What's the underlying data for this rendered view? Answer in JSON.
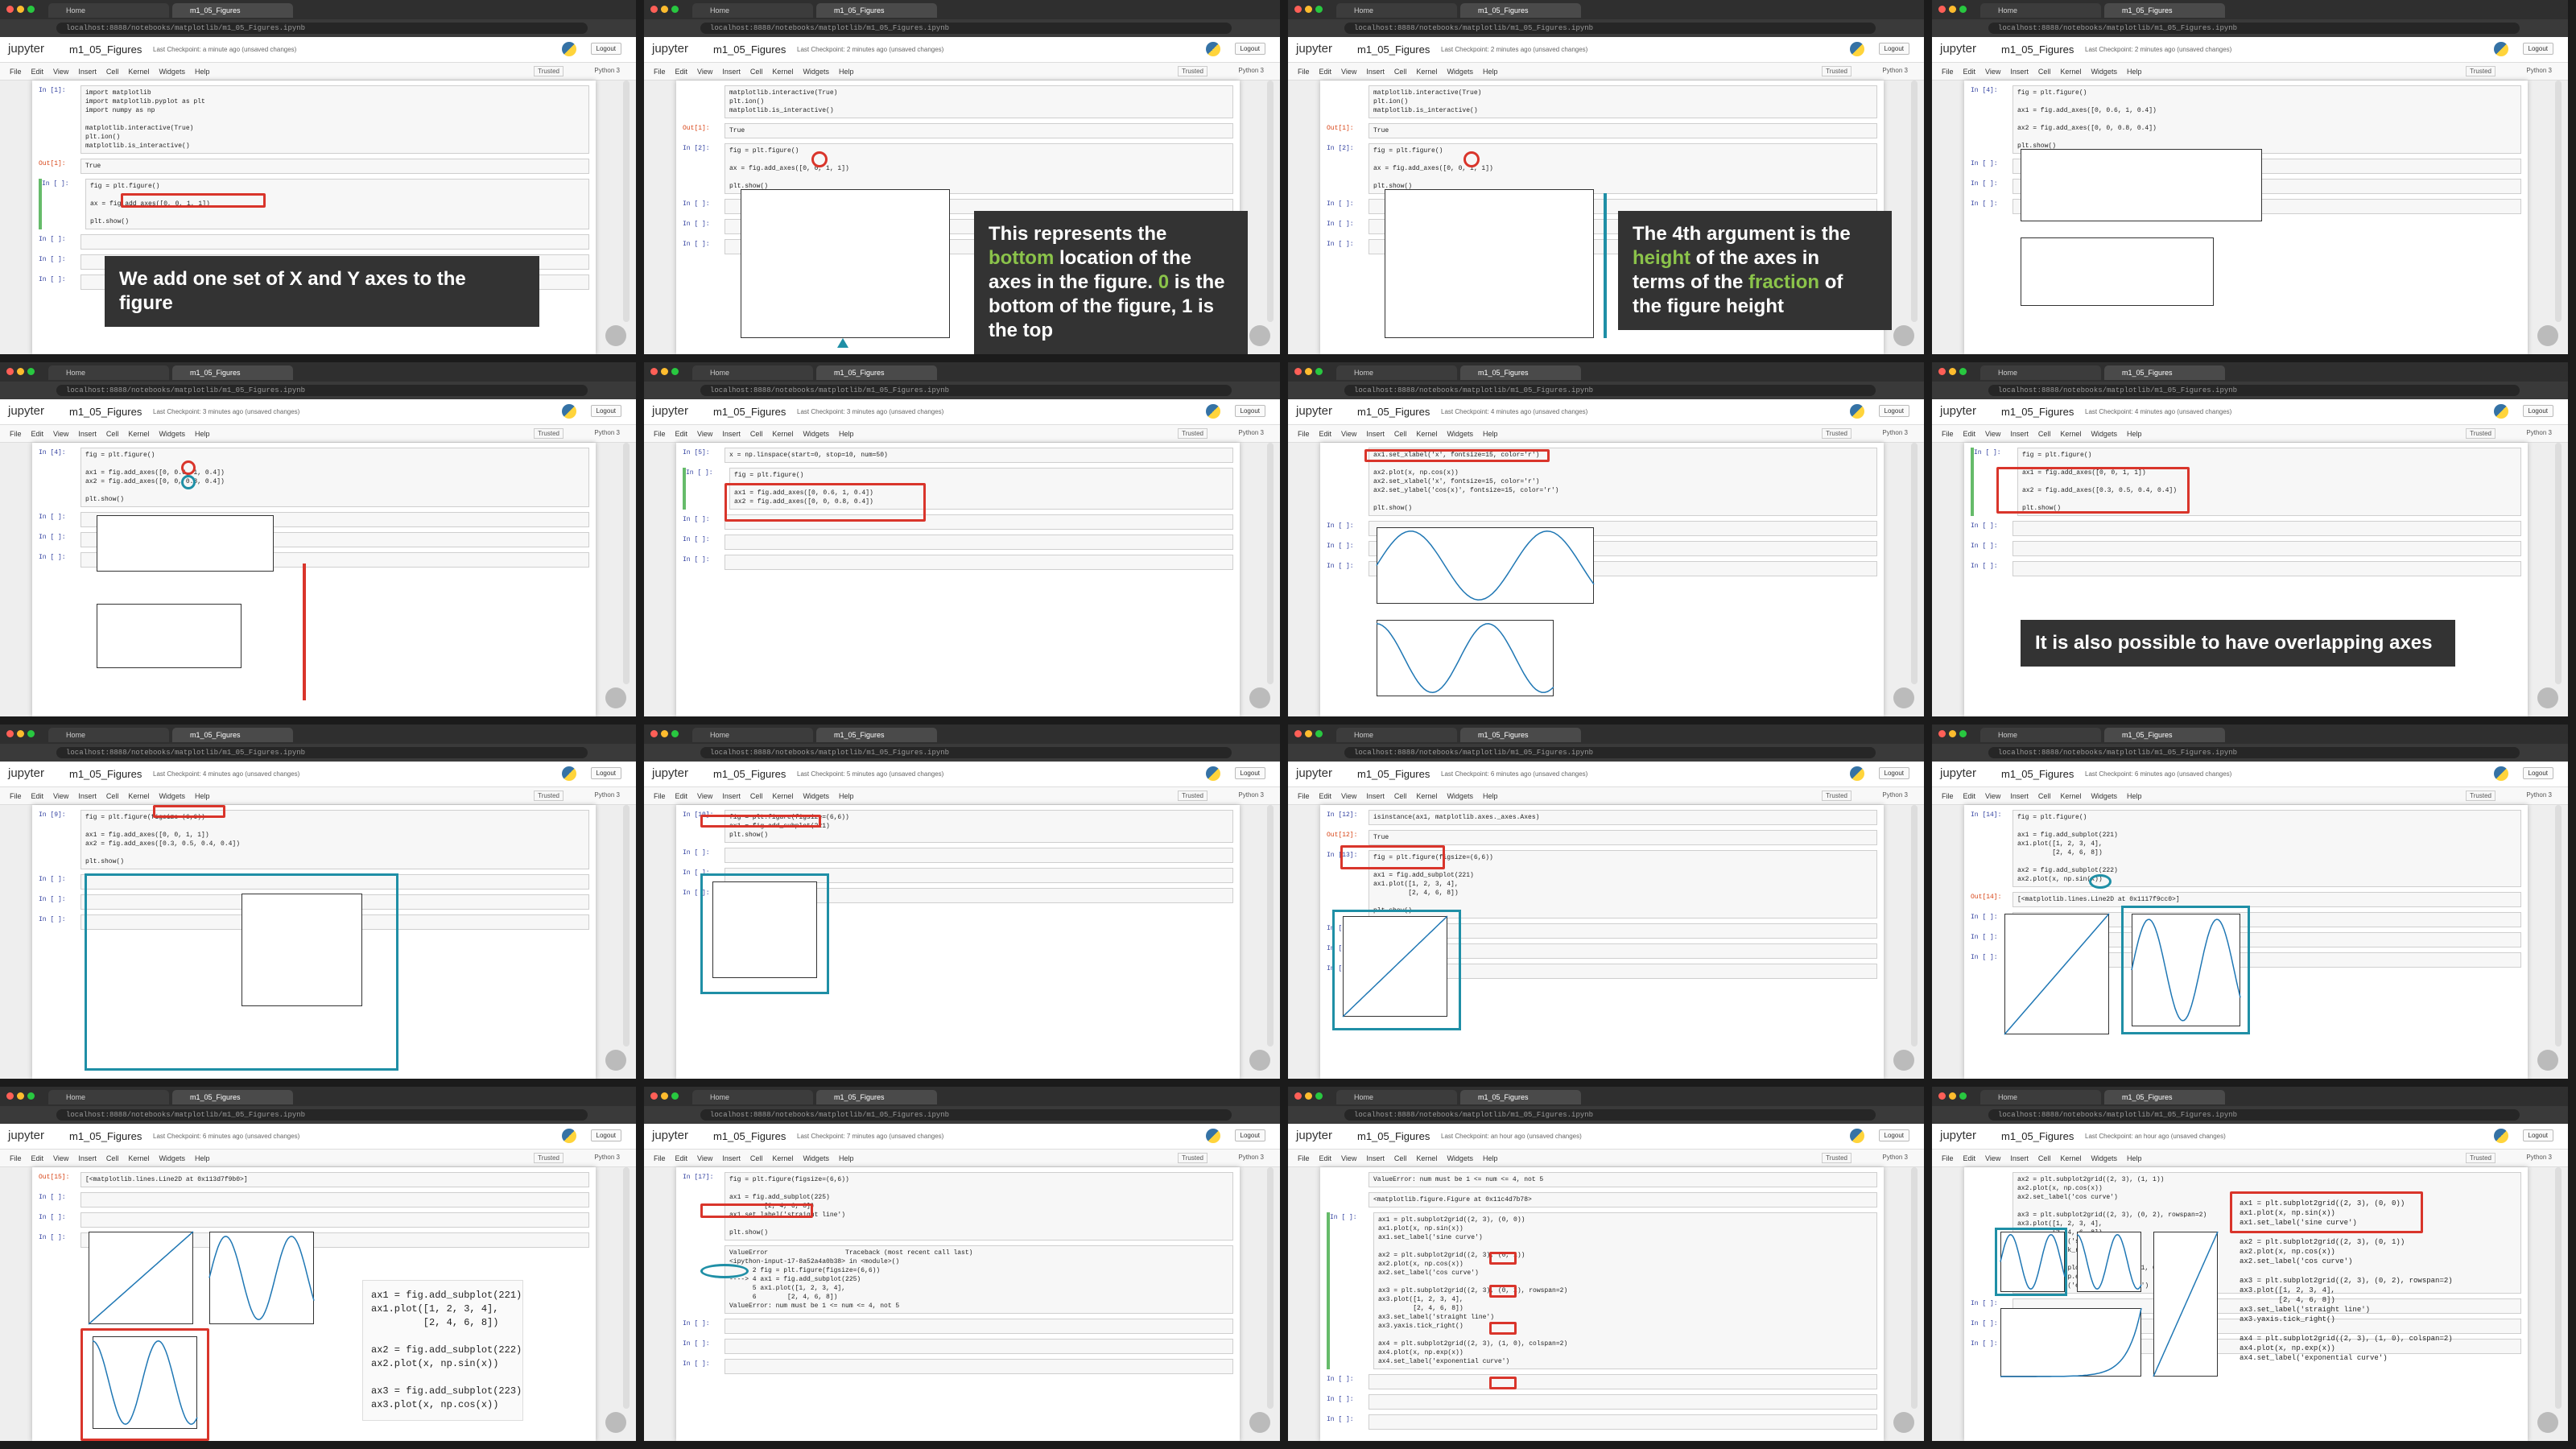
{
  "browser": {
    "tab_home": "Home",
    "tab_notebook": "m1_05_Figures",
    "url": "localhost:8888/notebooks/matplotlib/m1_05_Figures.ipynb"
  },
  "jupyter": {
    "logo": "jupyter",
    "notebook_name": "m1_05_Figures",
    "logout": "Logout",
    "trusted": "Trusted",
    "kernel": "Python 3",
    "menu": [
      "File",
      "Edit",
      "View",
      "Insert",
      "Cell",
      "Kernel",
      "Widgets",
      "Help"
    ]
  },
  "tiles": [
    {
      "checkpoint": "Last Checkpoint: a minute ago   (unsaved changes)",
      "cells": [
        {
          "prompt": "In [1]:",
          "src": "import matplotlib\nimport matplotlib.pyplot as plt\nimport numpy as np\n\nmatplotlib.interactive(True)\nplt.ion()\nmatplotlib.is_interactive()"
        },
        {
          "prompt": "Out[1]:",
          "src": "True"
        },
        {
          "prompt": "In [ ]:",
          "src": "fig = plt.figure()\n\nax = fig.add_axes([0, 0, 1, 1])\n\nplt.show()"
        }
      ],
      "caption": "We add one set of X and Y axes to the figure"
    },
    {
      "checkpoint": "Last Checkpoint: 2 minutes ago   (unsaved changes)",
      "cells": [
        {
          "prompt": "",
          "src": "matplotlib.interactive(True)\nplt.ion()\nmatplotlib.is_interactive()"
        },
        {
          "prompt": "Out[1]:",
          "src": "True"
        },
        {
          "prompt": "In [2]:",
          "src": "fig = plt.figure()\n\nax = fig.add_axes([0, 0, 1, 1])\n\nplt.show()"
        }
      ],
      "caption_parts": [
        "This represents the ",
        "bottom",
        " location of the axes in the figure. ",
        "0",
        " is the bottom of the figure, 1 is the top"
      ]
    },
    {
      "checkpoint": "Last Checkpoint: 2 minutes ago   (unsaved changes)",
      "cells": [
        {
          "prompt": "",
          "src": "matplotlib.interactive(True)\nplt.ion()\nmatplotlib.is_interactive()"
        },
        {
          "prompt": "Out[1]:",
          "src": "True"
        },
        {
          "prompt": "In [2]:",
          "src": "fig = plt.figure()\n\nax = fig.add_axes([0, 0, 1, 1])\n\nplt.show()"
        }
      ],
      "caption_parts": [
        "The 4th argument is the ",
        "height",
        " of the axes in terms of the ",
        "fraction",
        " of the figure height"
      ]
    },
    {
      "checkpoint": "Last Checkpoint: 2 minutes ago   (unsaved changes)",
      "cells": [
        {
          "prompt": "In [4]:",
          "src": "fig = plt.figure()\n\nax1 = fig.add_axes([0, 0.6, 1, 0.4])\n\nax2 = fig.add_axes([0, 0, 0.8, 0.4])\n\nplt.show()"
        }
      ]
    },
    {
      "checkpoint": "Last Checkpoint: 3 minutes ago   (unsaved changes)",
      "cells": [
        {
          "prompt": "In [4]:",
          "src": "fig = plt.figure()\n\nax1 = fig.add_axes([0, 0.6, 1, 0.4])\nax2 = fig.add_axes([0, 0, 0.8, 0.4])\n\nplt.show()"
        }
      ]
    },
    {
      "checkpoint": "Last Checkpoint: 3 minutes ago   (unsaved changes)",
      "cells": [
        {
          "prompt": "In [5]:",
          "src": "x = np.linspace(start=0, stop=10, num=50)"
        },
        {
          "prompt": "In [ ]:",
          "src": "fig = plt.figure()\n\nax1 = fig.add_axes([0, 0.6, 1, 0.4])\nax2 = fig.add_axes([0, 0, 0.8, 0.4])"
        }
      ]
    },
    {
      "checkpoint": "Last Checkpoint: 4 minutes ago   (unsaved changes)",
      "cells": [
        {
          "prompt": "",
          "src": "ax1.set_xlabel('x', fontsize=15, color='r')\n\nax2.plot(x, np.cos(x))\nax2.set_xlabel('x', fontsize=15, color='r')\nax2.set_ylabel('cos(x)', fontsize=15, color='r')\n\nplt.show()"
        }
      ]
    },
    {
      "checkpoint": "Last Checkpoint: 4 minutes ago   (unsaved changes)",
      "cells": [
        {
          "prompt": "In [ ]:",
          "src": "fig = plt.figure()\n\nax1 = fig.add_axes([0, 0, 1, 1])\n\nax2 = fig.add_axes([0.3, 0.5, 0.4, 0.4])\n\nplt.show()"
        }
      ],
      "caption": "It is also possible to have overlapping axes"
    },
    {
      "checkpoint": "Last Checkpoint: 4 minutes ago   (unsaved changes)",
      "cells": [
        {
          "prompt": "In [9]:",
          "src": "fig = plt.figure(figsize=(6,6))\n\nax1 = fig.add_axes([0, 0, 1, 1])\nax2 = fig.add_axes([0.3, 0.5, 0.4, 0.4])\n\nplt.show()"
        }
      ]
    },
    {
      "checkpoint": "Last Checkpoint: 5 minutes ago   (unsaved changes)",
      "cells": [
        {
          "prompt": "In [10]:",
          "src": "fig = plt.figure(figsize=(6,6))\nax1 = fig.add_subplot(221)\nplt.show()"
        }
      ]
    },
    {
      "checkpoint": "Last Checkpoint: 6 minutes ago   (unsaved changes)",
      "cells": [
        {
          "prompt": "In [12]:",
          "src": "isinstance(ax1, matplotlib.axes._axes.Axes)"
        },
        {
          "prompt": "Out[12]:",
          "src": "True"
        },
        {
          "prompt": "In [13]:",
          "src": "fig = plt.figure(figsize=(6,6))\n\nax1 = fig.add_subplot(221)\nax1.plot([1, 2, 3, 4],\n         [2, 4, 6, 8])\n\nplt.show()"
        }
      ]
    },
    {
      "checkpoint": "Last Checkpoint: 6 minutes ago   (unsaved changes)",
      "cells": [
        {
          "prompt": "In [14]:",
          "src": "fig = plt.figure()\n\nax1 = fig.add_subplot(221)\nax1.plot([1, 2, 3, 4],\n         [2, 4, 6, 8])\n\nax2 = fig.add_subplot(222)\nax2.plot(x, np.sin(x))"
        },
        {
          "prompt": "Out[14]:",
          "src": "[<matplotlib.lines.Line2D at 0x1117f9cc0>]"
        }
      ]
    },
    {
      "checkpoint": "Last Checkpoint: 6 minutes ago   (unsaved changes)",
      "cells": [
        {
          "prompt": "Out[15]:",
          "src": "[<matplotlib.lines.Line2D at 0x113d7f9b0>]"
        }
      ],
      "overlay": "ax1 = fig.add_subplot(221)\nax1.plot([1, 2, 3, 4],\n         [2, 4, 6, 8])\n\nax2 = fig.add_subplot(222)\nax2.plot(x, np.sin(x))\n\nax3 = fig.add_subplot(223)\nax3.plot(x, np.cos(x))"
    },
    {
      "checkpoint": "Last Checkpoint: 7 minutes ago   (unsaved changes)",
      "cells": [
        {
          "prompt": "In [17]:",
          "src": "fig = plt.figure(figsize=(6,6))\n\nax1 = fig.add_subplot(225)\n         [2, 4, 6, 8])\nax1.set_label('straight line')\n\nplt.show()"
        },
        {
          "prompt": "",
          "src": "ValueError                    Traceback (most recent call last)\n<ipython-input-17-8a52a4a0b38> in <module>()\n      2 fig = plt.figure(figsize=(6,6))\n----> 4 ax1 = fig.add_subplot(225)\n      5 ax1.plot([1, 2, 3, 4],\n      6        [2, 4, 6, 8])\nValueError: num must be 1 <= num <= 4, not 5"
        }
      ]
    },
    {
      "checkpoint": "Last Checkpoint: an hour ago   (unsaved changes)",
      "cells": [
        {
          "prompt": "",
          "src": "ValueError: num must be 1 <= num <= 4, not 5"
        },
        {
          "prompt": "",
          "src": "<matplotlib.figure.Figure at 0x11c4d7b78>"
        },
        {
          "prompt": "In [ ]:",
          "src": "ax1 = plt.subplot2grid((2, 3), (0, 0))\nax1.plot(x, np.sin(x))\nax1.set_label('sine curve')\n\nax2 = plt.subplot2grid((2, 3), (0, 1))\nax2.plot(x, np.cos(x))\nax2.set_label('cos curve')\n\nax3 = plt.subplot2grid((2, 3), (0, 2), rowspan=2)\nax3.plot([1, 2, 3, 4],\n         [2, 4, 6, 8])\nax3.set_label('straight line')\nax3.yaxis.tick_right()\n\nax4 = plt.subplot2grid((2, 3), (1, 0), colspan=2)\nax4.plot(x, np.exp(x))\nax4.set_label('exponential curve')"
        }
      ]
    },
    {
      "checkpoint": "Last Checkpoint: an hour ago   (unsaved changes)",
      "cells": [
        {
          "prompt": "",
          "src": "ax2 = plt.subplot2grid((2, 3), (1, 1))\nax2.plot(x, np.cos(x))\nax2.set_label('cos curve')\n\nax3 = plt.subplot2grid((2, 3), (0, 2), rowspan=2)\nax3.plot([1, 2, 3, 4],\n         [2, 4, 6, 8])\nax3.set_label('straight line')\nax3.yaxis.tick_right()\n\nax4 = plt.subplot2grid((2, 3), (1, 0), colspan=2)\nax4.plot(x, np.exp(x))\nax4.set_label('exponential curve')"
        }
      ],
      "overlay": "ax1 = plt.subplot2grid((2, 3), (0, 0))\nax1.plot(x, np.sin(x))\nax1.set_label('sine curve')\n\nax2 = plt.subplot2grid((2, 3), (0, 1))\nax2.plot(x, np.cos(x))\nax2.set_label('cos curve')\n\nax3 = plt.subplot2grid((2, 3), (0, 2), rowspan=2)\nax3.plot([1, 2, 3, 4],\n         [2, 4, 6, 8])\nax3.set_label('straight line')\nax3.yaxis.tick_right()\n\nax4 = plt.subplot2grid((2, 3), (1, 0), colspan=2)\nax4.plot(x, np.exp(x))\nax4.set_label('exponential curve')"
    }
  ]
}
